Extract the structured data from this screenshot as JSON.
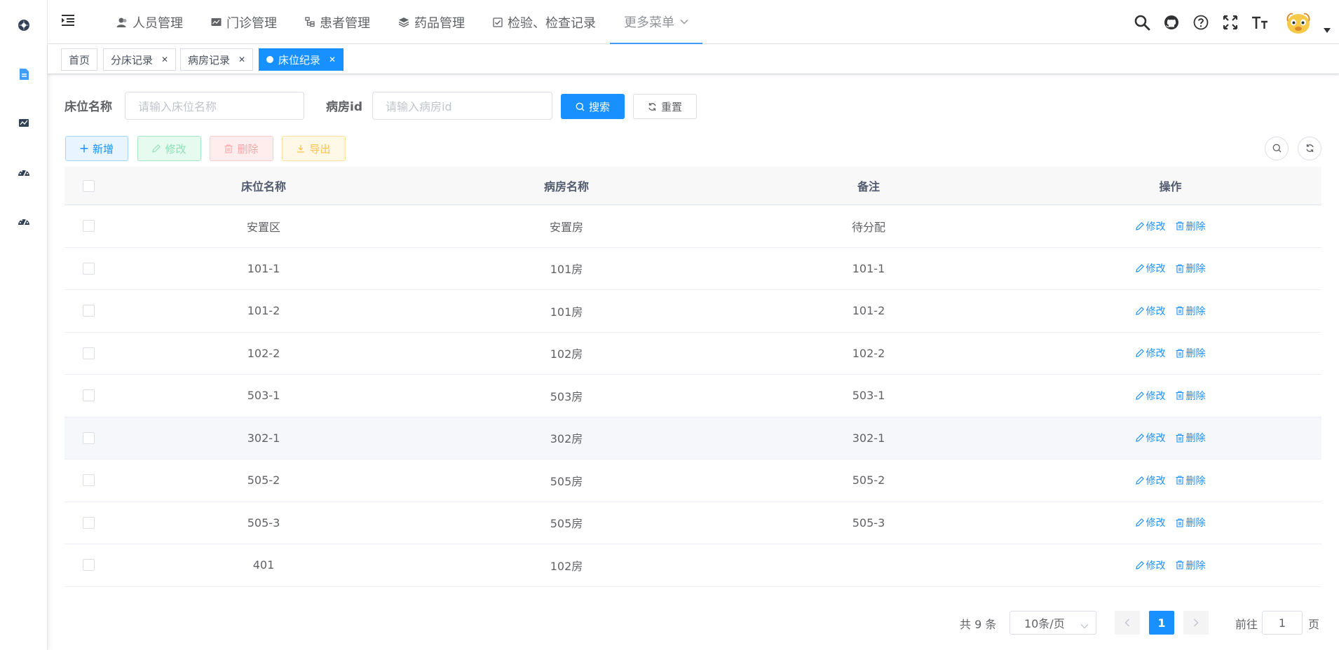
{
  "colors": {
    "primary": "#1890ff",
    "success": "#13ce66",
    "danger": "#ff4949",
    "warning": "#ffba00"
  },
  "sidebar": {
    "icons": [
      "compass-icon",
      "document-icon",
      "monitor-icon",
      "dashboard-icon",
      "dashboard-icon-2"
    ]
  },
  "topmenu": {
    "items": [
      {
        "label": "人员管理",
        "icon": "user-icon"
      },
      {
        "label": "门诊管理",
        "icon": "monitor-icon"
      },
      {
        "label": "患者管理",
        "icon": "tree-icon"
      },
      {
        "label": "药品管理",
        "icon": "layers-icon"
      },
      {
        "label": "检验、检查记录",
        "icon": "checkbox-icon"
      },
      {
        "label": "更多菜单",
        "icon": "chevron-down-icon"
      }
    ],
    "tools": [
      "search-icon",
      "github-icon",
      "question-icon",
      "fullscreen-icon",
      "font-size-icon"
    ]
  },
  "tags": [
    {
      "label": "首页"
    },
    {
      "label": "分床记录"
    },
    {
      "label": "病房记录"
    },
    {
      "label": "床位纪录"
    }
  ],
  "search": {
    "bed_label": "床位名称",
    "bed_placeholder": "请输入床位名称",
    "room_label": "病房id",
    "room_placeholder": "请输入病房id",
    "search_btn": "搜索",
    "reset_btn": "重置"
  },
  "toolbar": {
    "add": "新增",
    "edit": "修改",
    "delete": "删除",
    "export": "导出"
  },
  "table": {
    "headers": {
      "name": "床位名称",
      "room": "病房名称",
      "note": "备注",
      "op": "操作"
    },
    "op_edit": "修改",
    "op_delete": "删除",
    "rows": [
      {
        "name": "安置区",
        "room": "安置房",
        "note": "待分配"
      },
      {
        "name": "101-1",
        "room": "101房",
        "note": "101-1"
      },
      {
        "name": "101-2",
        "room": "101房",
        "note": "101-2"
      },
      {
        "name": "102-2",
        "room": "102房",
        "note": "102-2"
      },
      {
        "name": "503-1",
        "room": "503房",
        "note": "503-1"
      },
      {
        "name": "302-1",
        "room": "302房",
        "note": "302-1"
      },
      {
        "name": "505-2",
        "room": "505房",
        "note": "505-2"
      },
      {
        "name": "505-3",
        "room": "505房",
        "note": "505-3"
      },
      {
        "name": "401",
        "room": "102房",
        "note": ""
      }
    ]
  },
  "pagination": {
    "total": "共 9 条",
    "page_size": "10条/页",
    "current_page": "1",
    "goto_label": "前往",
    "goto_value": "1",
    "page_unit": "页"
  }
}
